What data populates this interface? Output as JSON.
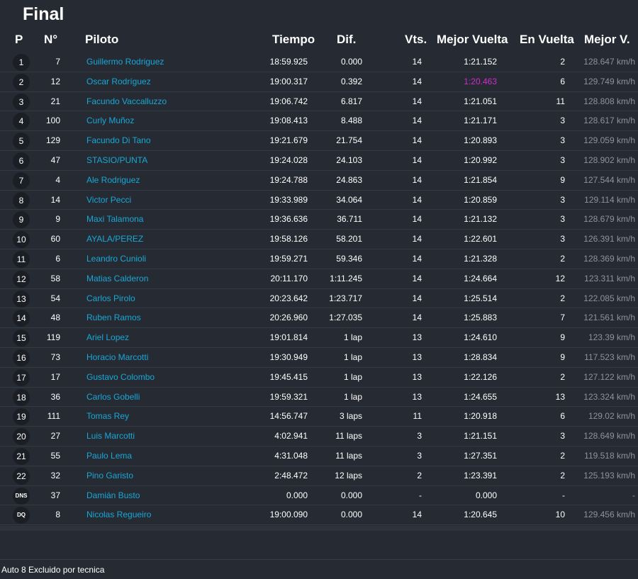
{
  "title": "Final",
  "columns": {
    "pos": "P",
    "num": "N°",
    "driver": "Piloto",
    "time": "Tiempo",
    "diff": "Dif.",
    "laps": "Vts.",
    "best_lap": "Mejor Vuelta",
    "on_lap": "En Vuelta",
    "best_speed": "Mejor V."
  },
  "colors": {
    "background": "#262b33",
    "driver_link": "#19a7d6",
    "fastest_lap": "#d42bd0",
    "speed_text": "#8d939b"
  },
  "rows": [
    {
      "pos": "1",
      "num": "7",
      "driver": "Guillermo Rodriguez",
      "time": "18:59.925",
      "diff": "0.000",
      "laps": "14",
      "best_lap": "1:21.152",
      "on_lap": "2",
      "best_speed": "128.647 km/h",
      "fastest": false
    },
    {
      "pos": "2",
      "num": "12",
      "driver": "Oscar Rodríguez",
      "time": "19:00.317",
      "diff": "0.392",
      "laps": "14",
      "best_lap": "1:20.463",
      "on_lap": "6",
      "best_speed": "129.749 km/h",
      "fastest": true
    },
    {
      "pos": "3",
      "num": "21",
      "driver": "Facundo Vaccalluzzo",
      "time": "19:06.742",
      "diff": "6.817",
      "laps": "14",
      "best_lap": "1:21.051",
      "on_lap": "11",
      "best_speed": "128.808 km/h",
      "fastest": false
    },
    {
      "pos": "4",
      "num": "100",
      "driver": "Curly Muñoz",
      "time": "19:08.413",
      "diff": "8.488",
      "laps": "14",
      "best_lap": "1:21.171",
      "on_lap": "3",
      "best_speed": "128.617 km/h",
      "fastest": false
    },
    {
      "pos": "5",
      "num": "129",
      "driver": "Facundo Di Tano",
      "time": "19:21.679",
      "diff": "21.754",
      "laps": "14",
      "best_lap": "1:20.893",
      "on_lap": "3",
      "best_speed": "129.059 km/h",
      "fastest": false
    },
    {
      "pos": "6",
      "num": "47",
      "driver": "STASIO/PUNTA",
      "time": "19:24.028",
      "diff": "24.103",
      "laps": "14",
      "best_lap": "1:20.992",
      "on_lap": "3",
      "best_speed": "128.902 km/h",
      "fastest": false
    },
    {
      "pos": "7",
      "num": "4",
      "driver": "Ale Rodriguez",
      "time": "19:24.788",
      "diff": "24.863",
      "laps": "14",
      "best_lap": "1:21.854",
      "on_lap": "9",
      "best_speed": "127.544 km/h",
      "fastest": false
    },
    {
      "pos": "8",
      "num": "14",
      "driver": "Victor Pecci",
      "time": "19:33.989",
      "diff": "34.064",
      "laps": "14",
      "best_lap": "1:20.859",
      "on_lap": "3",
      "best_speed": "129.114 km/h",
      "fastest": false
    },
    {
      "pos": "9",
      "num": "9",
      "driver": "Maxi Talamona",
      "time": "19:36.636",
      "diff": "36.711",
      "laps": "14",
      "best_lap": "1:21.132",
      "on_lap": "3",
      "best_speed": "128.679 km/h",
      "fastest": false
    },
    {
      "pos": "10",
      "num": "60",
      "driver": "AYALA/PEREZ",
      "time": "19:58.126",
      "diff": "58.201",
      "laps": "14",
      "best_lap": "1:22.601",
      "on_lap": "3",
      "best_speed": "126.391 km/h",
      "fastest": false
    },
    {
      "pos": "11",
      "num": "6",
      "driver": "Leandro Cunioli",
      "time": "19:59.271",
      "diff": "59.346",
      "laps": "14",
      "best_lap": "1:21.328",
      "on_lap": "2",
      "best_speed": "128.369 km/h",
      "fastest": false
    },
    {
      "pos": "12",
      "num": "58",
      "driver": "Matias Calderon",
      "time": "20:11.170",
      "diff": "1:11.245",
      "laps": "14",
      "best_lap": "1:24.664",
      "on_lap": "12",
      "best_speed": "123.311 km/h",
      "fastest": false
    },
    {
      "pos": "13",
      "num": "54",
      "driver": "Carlos Pirolo",
      "time": "20:23.642",
      "diff": "1:23.717",
      "laps": "14",
      "best_lap": "1:25.514",
      "on_lap": "2",
      "best_speed": "122.085 km/h",
      "fastest": false
    },
    {
      "pos": "14",
      "num": "48",
      "driver": "Ruben Ramos",
      "time": "20:26.960",
      "diff": "1:27.035",
      "laps": "14",
      "best_lap": "1:25.883",
      "on_lap": "7",
      "best_speed": "121.561 km/h",
      "fastest": false
    },
    {
      "pos": "15",
      "num": "119",
      "driver": "Ariel Lopez",
      "time": "19:01.814",
      "diff": "1 lap",
      "laps": "13",
      "best_lap": "1:24.610",
      "on_lap": "9",
      "best_speed": "123.39 km/h",
      "fastest": false
    },
    {
      "pos": "16",
      "num": "73",
      "driver": "Horacio Marcotti",
      "time": "19:30.949",
      "diff": "1 lap",
      "laps": "13",
      "best_lap": "1:28.834",
      "on_lap": "9",
      "best_speed": "117.523 km/h",
      "fastest": false
    },
    {
      "pos": "17",
      "num": "17",
      "driver": "Gustavo Colombo",
      "time": "19:45.415",
      "diff": "1 lap",
      "laps": "13",
      "best_lap": "1:22.126",
      "on_lap": "2",
      "best_speed": "127.122 km/h",
      "fastest": false
    },
    {
      "pos": "18",
      "num": "36",
      "driver": "Carlos Gobelli",
      "time": "19:59.321",
      "diff": "1 lap",
      "laps": "13",
      "best_lap": "1:24.655",
      "on_lap": "13",
      "best_speed": "123.324 km/h",
      "fastest": false
    },
    {
      "pos": "19",
      "num": "111",
      "driver": "Tomas Rey",
      "time": "14:56.747",
      "diff": "3 laps",
      "laps": "11",
      "best_lap": "1:20.918",
      "on_lap": "6",
      "best_speed": "129.02 km/h",
      "fastest": false
    },
    {
      "pos": "20",
      "num": "27",
      "driver": "Luis Marcotti",
      "time": "4:02.941",
      "diff": "11 laps",
      "laps": "3",
      "best_lap": "1:21.151",
      "on_lap": "3",
      "best_speed": "128.649 km/h",
      "fastest": false
    },
    {
      "pos": "21",
      "num": "55",
      "driver": "Paulo Lema",
      "time": "4:31.048",
      "diff": "11 laps",
      "laps": "3",
      "best_lap": "1:27.351",
      "on_lap": "2",
      "best_speed": "119.518 km/h",
      "fastest": false
    },
    {
      "pos": "22",
      "num": "32",
      "driver": "Pino Garisto",
      "time": "2:48.472",
      "diff": "12 laps",
      "laps": "2",
      "best_lap": "1:23.391",
      "on_lap": "2",
      "best_speed": "125.193 km/h",
      "fastest": false
    },
    {
      "pos": "DNS",
      "num": "37",
      "driver": "Damián Busto",
      "time": "0.000",
      "diff": "0.000",
      "laps": "-",
      "best_lap": "0.000",
      "on_lap": "-",
      "best_speed": "-",
      "fastest": false
    },
    {
      "pos": "DQ",
      "num": "8",
      "driver": "Nicolas Regueiro",
      "time": "19:00.090",
      "diff": "0.000",
      "laps": "14",
      "best_lap": "1:20.645",
      "on_lap": "10",
      "best_speed": "129.456 km/h",
      "fastest": false
    }
  ],
  "footer": {
    "note": "Auto 8 Excluido por tecnica"
  }
}
